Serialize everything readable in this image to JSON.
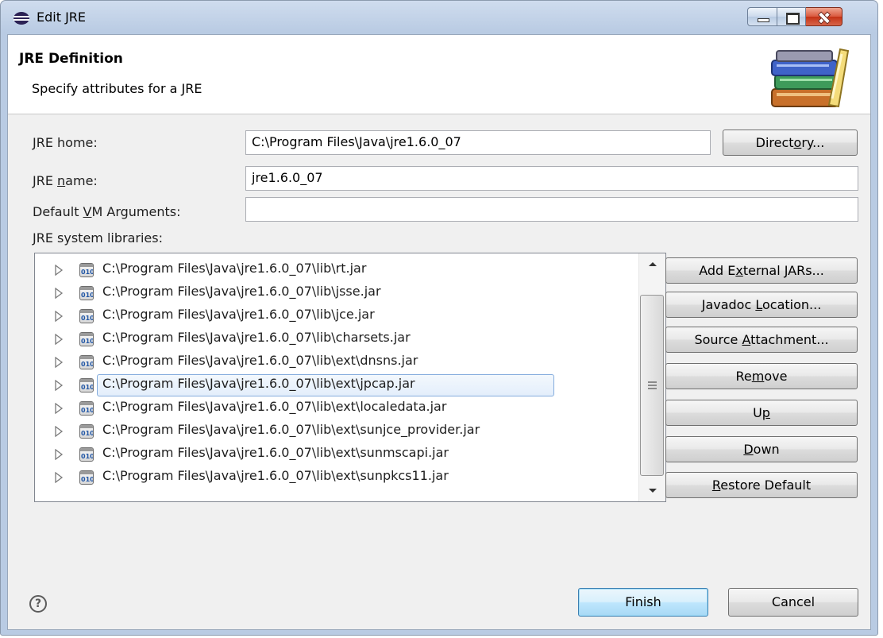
{
  "window": {
    "title": "Edit JRE"
  },
  "header": {
    "title": "JRE Definition",
    "description": "Specify attributes for a JRE"
  },
  "form": {
    "jre_home": {
      "label_pre": "",
      "label_mnemonic": "J",
      "label_post": "RE home:",
      "value": "C:\\Program Files\\Java\\jre1.6.0_07"
    },
    "directory_button": {
      "pre": "Direct",
      "mnemonic": "o",
      "post": "ry..."
    },
    "jre_name": {
      "label_pre": "JRE ",
      "label_mnemonic": "n",
      "label_post": "ame:",
      "value": "jre1.6.0_07"
    },
    "vm_args": {
      "label_pre": "Default ",
      "label_mnemonic": "V",
      "label_post": "M Arguments:",
      "value": ""
    },
    "libraries_label": "JRE system libraries:"
  },
  "libraries": [
    {
      "path": "C:\\Program Files\\Java\\jre1.6.0_07\\lib\\rt.jar",
      "selected": false
    },
    {
      "path": "C:\\Program Files\\Java\\jre1.6.0_07\\lib\\jsse.jar",
      "selected": false
    },
    {
      "path": "C:\\Program Files\\Java\\jre1.6.0_07\\lib\\jce.jar",
      "selected": false
    },
    {
      "path": "C:\\Program Files\\Java\\jre1.6.0_07\\lib\\charsets.jar",
      "selected": false
    },
    {
      "path": "C:\\Program Files\\Java\\jre1.6.0_07\\lib\\ext\\dnsns.jar",
      "selected": false
    },
    {
      "path": "C:\\Program Files\\Java\\jre1.6.0_07\\lib\\ext\\jpcap.jar",
      "selected": true
    },
    {
      "path": "C:\\Program Files\\Java\\jre1.6.0_07\\lib\\ext\\localedata.jar",
      "selected": false
    },
    {
      "path": "C:\\Program Files\\Java\\jre1.6.0_07\\lib\\ext\\sunjce_provider.jar",
      "selected": false
    },
    {
      "path": "C:\\Program Files\\Java\\jre1.6.0_07\\lib\\ext\\sunmscapi.jar",
      "selected": false
    },
    {
      "path": "C:\\Program Files\\Java\\jre1.6.0_07\\lib\\ext\\sunpkcs11.jar",
      "selected": false
    }
  ],
  "jar_icon_text": "010",
  "side_buttons": {
    "add_external_jars": {
      "pre": "Add E",
      "mnemonic": "x",
      "post": "ternal JARs..."
    },
    "javadoc_location": {
      "pre": "Javadoc ",
      "mnemonic": "L",
      "post": "ocation..."
    },
    "source_attachment": {
      "pre": "Source ",
      "mnemonic": "A",
      "post": "ttachment..."
    },
    "remove": {
      "pre": "Re",
      "mnemonic": "m",
      "post": "ove"
    },
    "up": {
      "pre": "U",
      "mnemonic": "p",
      "post": ""
    },
    "down": {
      "pre": "",
      "mnemonic": "D",
      "post": "own"
    },
    "restore_default": {
      "pre": "",
      "mnemonic": "R",
      "post": "estore Default"
    }
  },
  "footer": {
    "help_glyph": "?",
    "finish_label": "Finish",
    "cancel_label": "Cancel"
  },
  "icons": {
    "app": "eclipse-icon",
    "header_art": "books-library-icon",
    "jar": "jar-file-icon",
    "expand": "expand-arrow-icon",
    "help": "help-icon"
  },
  "colors": {
    "titlebar": "#b9cbe3",
    "close_button": "#c43215",
    "default_button": "#bee6fd",
    "selection_border": "#84acdd"
  }
}
